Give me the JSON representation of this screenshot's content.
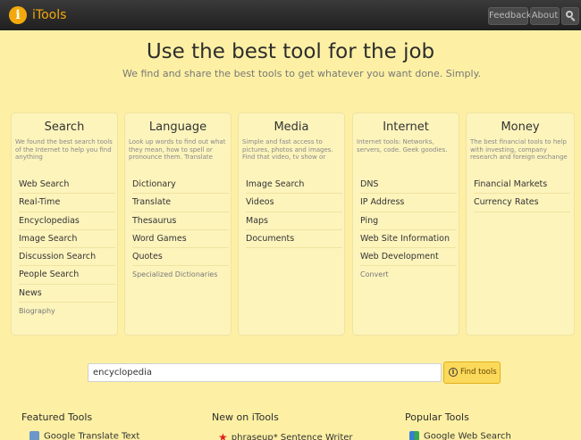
{
  "app": {
    "logo_glyph": "i",
    "name": "iTools"
  },
  "topbar": {
    "feedback": "Feedback",
    "about": "About"
  },
  "hero": {
    "title": "Use the best tool for the job",
    "subtitle": "We find and share the best tools to get whatever you want done. Simply."
  },
  "categories": [
    {
      "title": "Search",
      "desc": "We found the best search tools of the Internet to help you find anything",
      "links": [
        "Web Search",
        "Real-Time",
        "Encyclopedias",
        "Image Search",
        "Discussion Search",
        "People Search",
        "News",
        "Biography"
      ]
    },
    {
      "title": "Language",
      "desc": "Look up words to find out what they mean, how to spell or pronounce them. Translate",
      "links": [
        "Dictionary",
        "Translate",
        "Thesaurus",
        "Word Games",
        "Quotes",
        "Specialized Dictionaries"
      ]
    },
    {
      "title": "Media",
      "desc": "Simple and fast access to pictures, photos and images. Find that video, tv show or",
      "links": [
        "Image Search",
        "Videos",
        "Maps",
        "Documents"
      ]
    },
    {
      "title": "Internet",
      "desc": "Internet tools: Networks, servers, code. Geek goodies.",
      "links": [
        "DNS",
        "IP Address",
        "Ping",
        "Web Site Information",
        "Web Development",
        "Convert"
      ]
    },
    {
      "title": "Money",
      "desc": "The best financial tools to help with investing, company research and foreign exchange",
      "links": [
        "Financial Markets",
        "Currency Rates"
      ]
    }
  ],
  "search": {
    "value": "encyclopedia",
    "button": "Find tools",
    "button_icon_glyph": "i"
  },
  "featured": {
    "heading": "Featured Tools",
    "item": "Google Translate Text"
  },
  "new_on": {
    "heading": "New on iTools",
    "star_glyph": "★",
    "item": "phraseup* Sentence Writer"
  },
  "popular": {
    "heading": "Popular Tools",
    "item": "Google Web Search"
  },
  "colors": {
    "accent": "#f3a90c",
    "background": "#fdf0a4",
    "button": "#fbd95b"
  }
}
